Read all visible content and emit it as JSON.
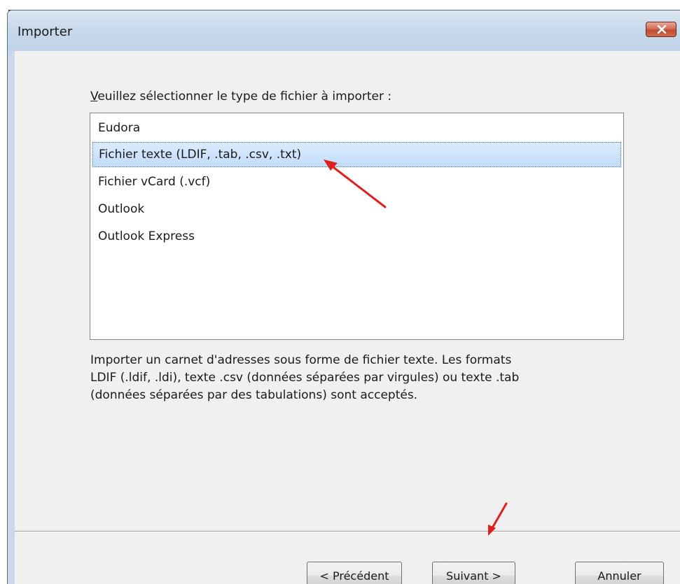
{
  "window": {
    "title": "Importer",
    "close_icon": "close-icon"
  },
  "dialog": {
    "prompt_prefix": "V",
    "prompt_rest": "euillez sélectionner le type de fichier à importer :",
    "file_types": [
      {
        "label": "Eudora",
        "selected": false
      },
      {
        "label": "Fichier texte (LDIF, .tab, .csv, .txt)",
        "selected": true
      },
      {
        "label": "Fichier vCard (.vcf)",
        "selected": false
      },
      {
        "label": "Outlook",
        "selected": false
      },
      {
        "label": "Outlook Express",
        "selected": false
      }
    ],
    "description_lines": [
      "Importer un carnet d'adresses sous forme de fichier texte. Les formats",
      "LDIF (.ldif, .ldi), texte .csv (données séparées par virgules) ou texte .tab",
      "(données séparées par des tabulations) sont acceptés."
    ]
  },
  "buttons": {
    "previous": "< Précédent",
    "next": "Suivant >",
    "cancel": "Annuler"
  },
  "colors": {
    "selection": "#c1dcfc",
    "annotation_arrow": "#e0201c",
    "close_button": "#c14a32"
  }
}
